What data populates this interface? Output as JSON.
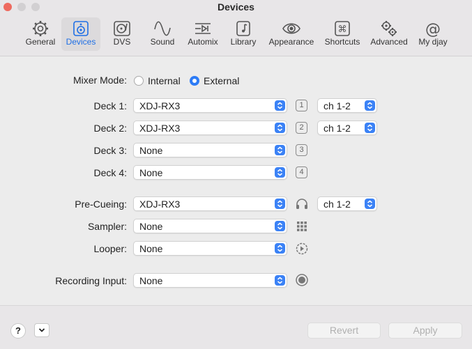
{
  "window": {
    "title": "Devices"
  },
  "tabs": [
    {
      "label": "General",
      "icon": "gear-icon"
    },
    {
      "label": "Devices",
      "icon": "speaker-icon",
      "active": true
    },
    {
      "label": "DVS",
      "icon": "turntable-icon"
    },
    {
      "label": "Sound",
      "icon": "waveform-icon"
    },
    {
      "label": "Automix",
      "icon": "automix-icon"
    },
    {
      "label": "Library",
      "icon": "library-icon"
    },
    {
      "label": "Appearance",
      "icon": "eye-icon"
    },
    {
      "label": "Shortcuts",
      "icon": "command-icon"
    },
    {
      "label": "Advanced",
      "icon": "gears-icon"
    },
    {
      "label": "My djay",
      "icon": "at-icon"
    }
  ],
  "mixer_mode": {
    "label": "Mixer Mode:",
    "options": [
      "Internal",
      "External"
    ],
    "selected": "External"
  },
  "decks": [
    {
      "label": "Deck 1:",
      "value": "XDJ-RX3",
      "number": "1",
      "channel": "ch 1-2"
    },
    {
      "label": "Deck 2:",
      "value": "XDJ-RX3",
      "number": "2",
      "channel": "ch 1-2"
    },
    {
      "label": "Deck 3:",
      "value": "None",
      "number": "3"
    },
    {
      "label": "Deck 4:",
      "value": "None",
      "number": "4"
    }
  ],
  "pre_cueing": {
    "label": "Pre-Cueing:",
    "value": "XDJ-RX3",
    "channel": "ch 1-2"
  },
  "sampler": {
    "label": "Sampler:",
    "value": "None"
  },
  "looper": {
    "label": "Looper:",
    "value": "None"
  },
  "recording": {
    "label": "Recording Input:",
    "value": "None"
  },
  "footer": {
    "help_label": "?",
    "revert_label": "Revert",
    "apply_label": "Apply"
  },
  "colors": {
    "accent": "#2d7cf6",
    "close": "#ee6a5f"
  }
}
